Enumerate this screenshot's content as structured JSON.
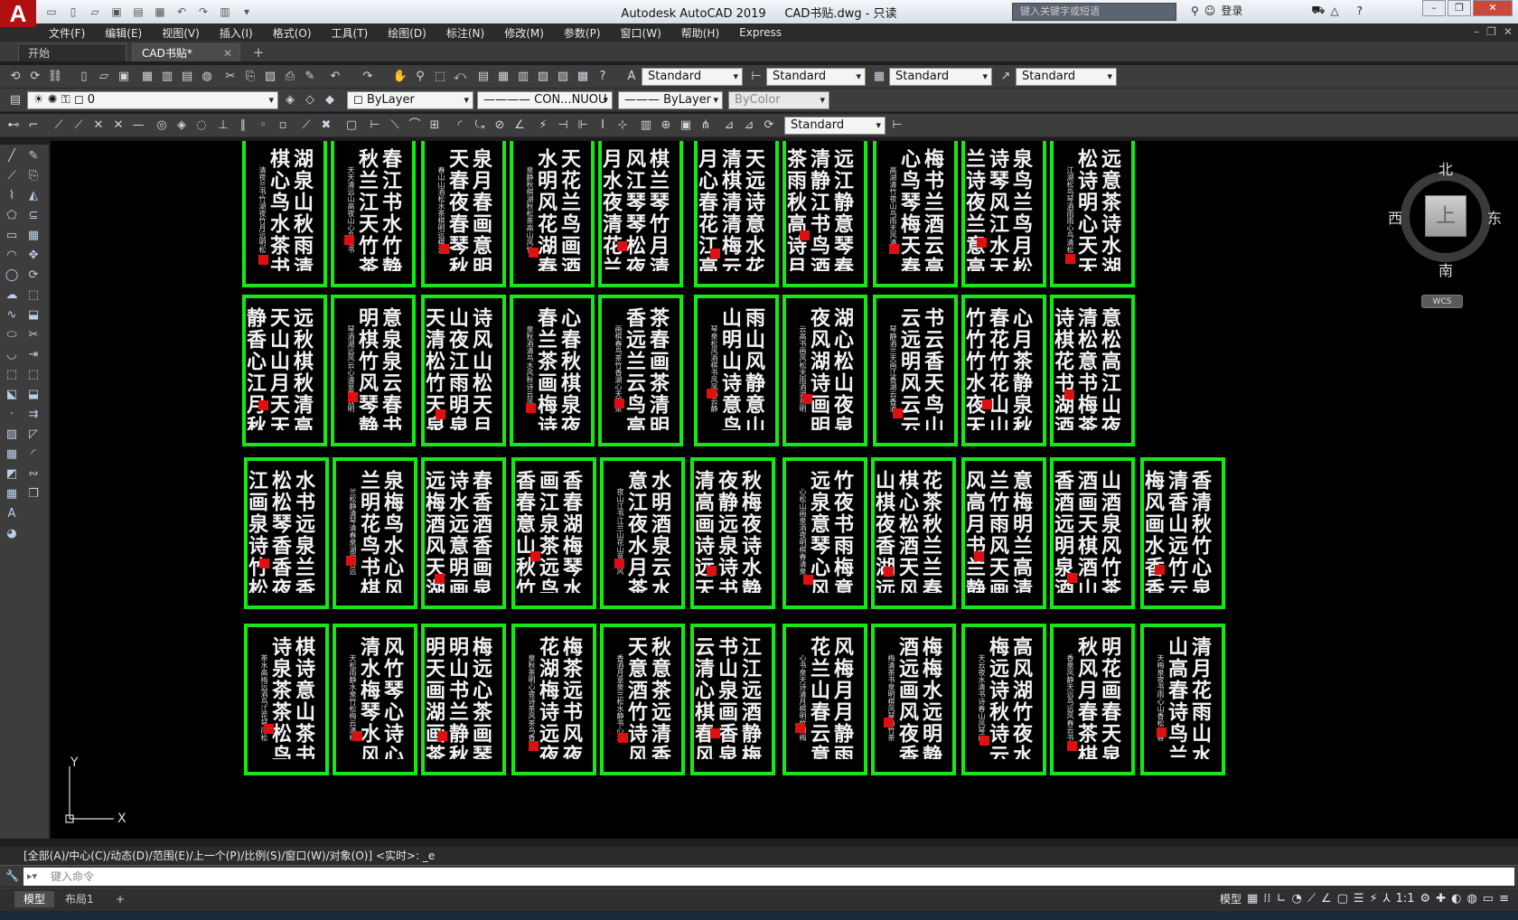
{
  "title_bar": {
    "app_title": "Autodesk AutoCAD 2019",
    "file_name": "CAD书贴.dwg - 只读",
    "search_placeholder": "键入关键字或短语",
    "login_label": "登录"
  },
  "menu": [
    "文件(F)",
    "编辑(E)",
    "视图(V)",
    "插入(I)",
    "格式(O)",
    "工具(T)",
    "绘图(D)",
    "标注(N)",
    "修改(M)",
    "参数(P)",
    "窗口(W)",
    "帮助(H)",
    "Express"
  ],
  "tabs": [
    {
      "label": "开始"
    },
    {
      "label": "CAD书贴*"
    }
  ],
  "toolbar": {
    "text_style": "Standard",
    "dim_style": "Standard",
    "table_style": "Standard",
    "multileader_style": "Standard",
    "layer": "0",
    "color": "ByLayer",
    "linetype": "CON...NUOU",
    "lineweight": "ByLayer",
    "plot_style": "ByColor",
    "dim_style_2": "Standard"
  },
  "viewcube": {
    "north": "北",
    "south": "南",
    "east": "东",
    "west": "西",
    "face": "上",
    "wcs": "WCS"
  },
  "ucs": {
    "x": "X",
    "y": "Y"
  },
  "command": {
    "history": "[全部(A)/中心(C)/动态(D)/范围(E)/上一个(P)/比例(S)/窗口(W)/对象(O)] <实时>: _e",
    "placeholder": "键入命令"
  },
  "layouts": [
    {
      "label": "模型"
    },
    {
      "label": "布局1"
    }
  ],
  "status": {
    "model_label": "模型",
    "scale": "1:1"
  },
  "colors": {
    "card_border": "#19e619",
    "seal": "#e01010",
    "canvas_bg": "#000000"
  }
}
